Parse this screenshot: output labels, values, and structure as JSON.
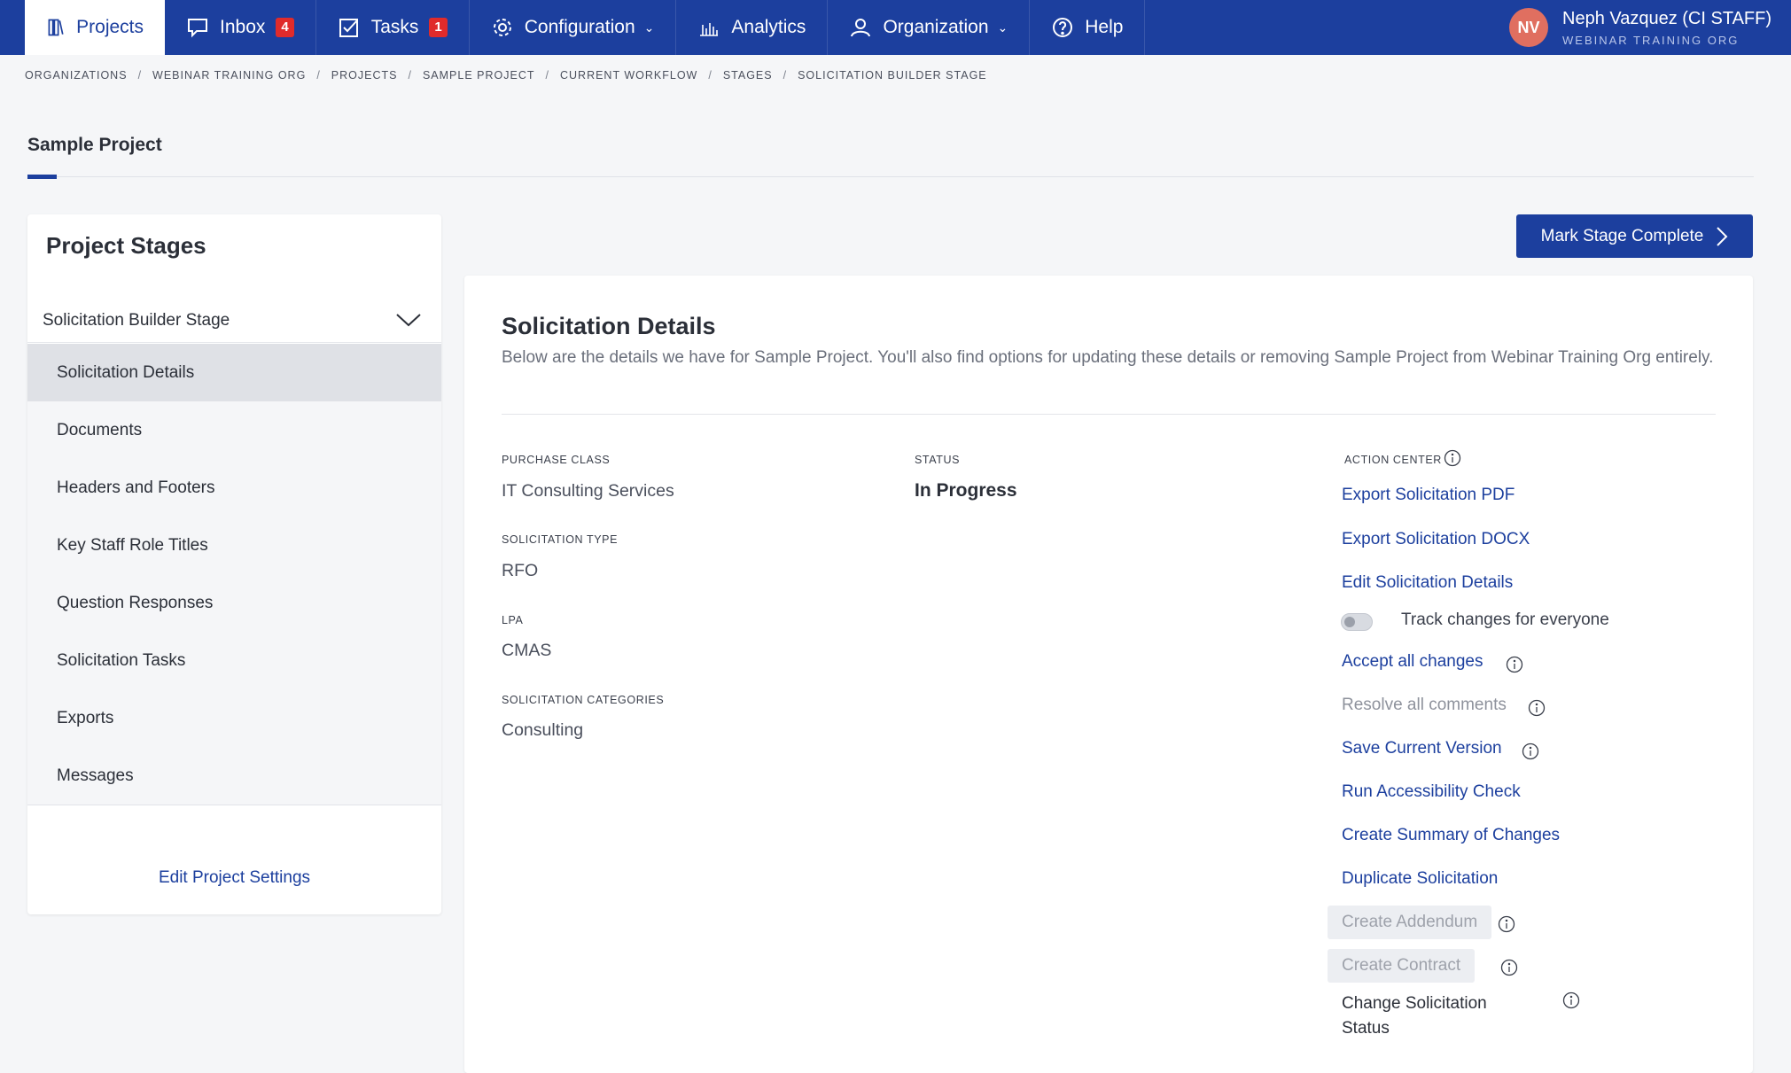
{
  "nav": {
    "items": [
      {
        "label": "Projects",
        "icon": "projects-icon"
      },
      {
        "label": "Inbox",
        "icon": "inbox-icon",
        "badge": "4"
      },
      {
        "label": "Tasks",
        "icon": "tasks-icon",
        "badge": "1"
      },
      {
        "label": "Configuration",
        "icon": "gear-icon"
      },
      {
        "label": "Analytics",
        "icon": "analytics-icon"
      },
      {
        "label": "Organization",
        "icon": "organization-icon"
      },
      {
        "label": "Help",
        "icon": "help-icon"
      }
    ],
    "user": {
      "initials": "NV",
      "name": "Neph Vazquez (CI STAFF)",
      "org": "WEBINAR TRAINING ORG"
    },
    "colors": {
      "primary": "#1c3f9e",
      "badge": "#e02b2b",
      "avatar": "#e06f60"
    }
  },
  "breadcrumb": [
    "ORGANIZATIONS",
    "WEBINAR TRAINING ORG",
    "PROJECTS",
    "SAMPLE PROJECT",
    "CURRENT WORKFLOW",
    "STAGES",
    "SOLICITATION BUILDER STAGE"
  ],
  "breadcrumb_sep": "/",
  "page": {
    "title": "Sample Project"
  },
  "sidebar": {
    "title": "Project Stages",
    "stage": "Solicitation Builder Stage",
    "items": [
      "Solicitation Details",
      "Documents",
      "Headers and Footers",
      "Key Staff Role Titles",
      "Question Responses",
      "Solicitation Tasks",
      "Exports",
      "Messages"
    ],
    "active_index": 0,
    "edit_settings": "Edit Project Settings"
  },
  "main": {
    "mark_complete": "Mark Stage Complete",
    "title": "Solicitation Details",
    "description": "Below are the details we have for Sample Project. You'll also find options for updating these details or removing Sample Project from Webinar Training Org entirely.",
    "fields": {
      "purchase_class": {
        "label": "PURCHASE CLASS",
        "value": "IT Consulting Services"
      },
      "solicitation_type": {
        "label": "SOLICITATION TYPE",
        "value": "RFO"
      },
      "lpa": {
        "label": "LPA",
        "value": "CMAS"
      },
      "categories": {
        "label": "SOLICITATION CATEGORIES",
        "value": "Consulting"
      },
      "status": {
        "label": "STATUS",
        "value": "In Progress"
      }
    },
    "action_center": {
      "label": "ACTION CENTER",
      "export_pdf": "Export Solicitation PDF",
      "export_docx": "Export Solicitation DOCX",
      "edit_details": "Edit Solicitation Details",
      "track_changes": "Track changes for everyone",
      "track_changes_on": false,
      "accept_changes": "Accept all changes",
      "resolve_comments": "Resolve all comments",
      "save_version": "Save Current Version",
      "accessibility": "Run Accessibility Check",
      "summary": "Create Summary of Changes",
      "duplicate": "Duplicate Solicitation",
      "addendum": "Create Addendum",
      "contract": "Create Contract",
      "change_status": "Change Solicitation Status"
    }
  }
}
